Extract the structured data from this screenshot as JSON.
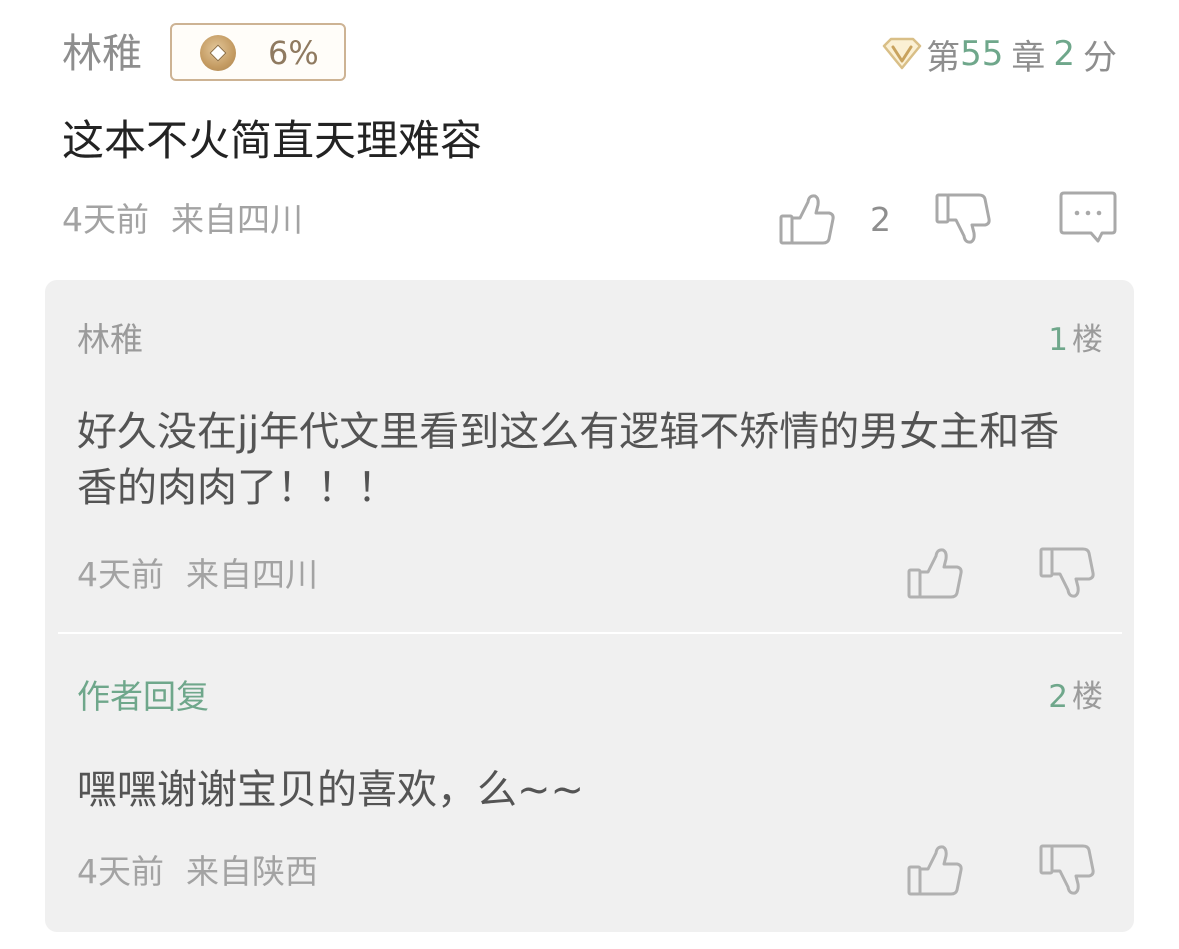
{
  "comment": {
    "username": "林稚",
    "badge_percent": "6%",
    "chapter": {
      "prefix": "第",
      "number": "55",
      "chapter_word": "章",
      "score": "2",
      "score_word": "分"
    },
    "text": "这本不火简直天理难容",
    "time": "4天前",
    "location": "来自四川",
    "like_count": "2"
  },
  "replies": [
    {
      "name": "林稚",
      "floor_number": "1",
      "floor_word": "楼",
      "text": "好久没在jj年代文里看到这么有逻辑不矫情的男女主和香香的肉肉了！！！",
      "time": "4天前",
      "location": "来自四川"
    },
    {
      "name": "作者回复",
      "floor_number": "2",
      "floor_word": "楼",
      "text": "嘿嘿谢谢宝贝的喜欢，么~~",
      "time": "4天前",
      "location": "来自陕西"
    }
  ],
  "colors": {
    "accent_green": "#6fa78b",
    "gold_border": "#cdb394",
    "panel_bg": "#f0f0f0",
    "meta_gray": "#a3a3a3"
  },
  "icons": {
    "badge": "coin-icon",
    "vip": "vip-diamond-icon",
    "like": "thumbs-up-icon",
    "dislike": "thumbs-down-icon",
    "reply": "comment-bubble-icon"
  }
}
